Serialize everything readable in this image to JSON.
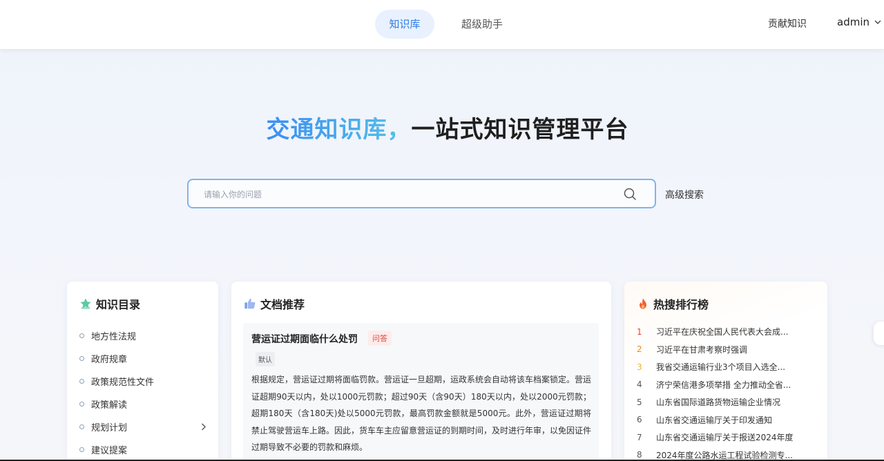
{
  "nav": {
    "tabs": [
      {
        "label": "知识库",
        "active": true
      },
      {
        "label": "超级助手",
        "active": false
      }
    ],
    "contribute_label": "贡献知识",
    "user_name": "admin",
    "accent_color": "#2b7be5"
  },
  "hero": {
    "title_highlight": "交通知识库，",
    "title_rest": "一站式知识管理平台",
    "search_placeholder": "请输入你的问题",
    "advanced_search_label": "高级搜索"
  },
  "catalog": {
    "title": "知识目录",
    "icon": "star-icon",
    "items": [
      {
        "label": "地方性法规",
        "has_children": false
      },
      {
        "label": "政府规章",
        "has_children": false
      },
      {
        "label": "政策规范性文件",
        "has_children": false
      },
      {
        "label": "政策解读",
        "has_children": false
      },
      {
        "label": "规划计划",
        "has_children": true
      },
      {
        "label": "建议提案",
        "has_children": false
      }
    ]
  },
  "docs": {
    "title": "文档推荐",
    "icon": "thumbs-up-icon",
    "items": [
      {
        "title": "营运证过期面临什么处罚",
        "tag": "问答",
        "label": "默认",
        "body": "根据规定，营运证过期将面临罚款。营运证一旦超期，运政系统会自动将该车档案锁定。营运证超期90天以内，处以1000元罚款；超过90天（含90天）180天以内，处以2000元罚款；超期180天（含180天)处以5000元罚款，最高罚款金额就是5000元。此外，营运证过期将禁止驾驶营运车上路。因此，货车车主应留意营运证的到期时间，及时进行年审，以免因证件过期导致不必要的罚款和麻烦。"
      }
    ]
  },
  "hot": {
    "title": "热搜排行榜",
    "icon": "fire-icon",
    "items": [
      {
        "rank": "1",
        "text": "习近平在庆祝全国人民代表大会成..."
      },
      {
        "rank": "2",
        "text": "习近平在甘肃考察时强调"
      },
      {
        "rank": "3",
        "text": "我省交通运输行业3个项目入选全..."
      },
      {
        "rank": "4",
        "text": "济宁荣信港多项举措 全力推动全省..."
      },
      {
        "rank": "5",
        "text": "山东省国际道路货物运输企业情况"
      },
      {
        "rank": "6",
        "text": "山东省交通运输厅关于印发通知"
      },
      {
        "rank": "7",
        "text": "山东省交通运输厅关于报送2024年度"
      },
      {
        "rank": "8",
        "text": "2024年度公路水运工程试验检测专..."
      }
    ]
  }
}
